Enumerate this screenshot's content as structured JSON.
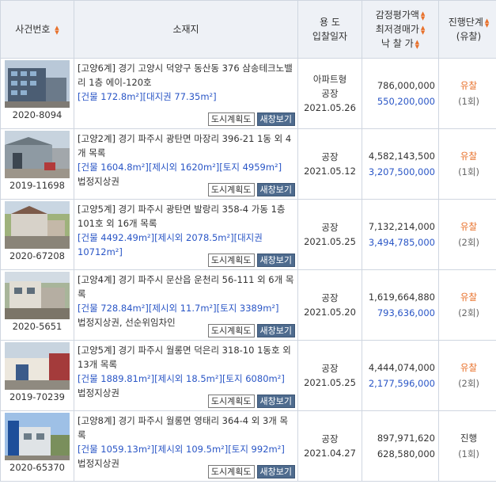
{
  "header": {
    "case": "사건번호",
    "location": "소재지",
    "use_line1": "용 도",
    "use_line2": "입찰일자",
    "price_line1": "감정평가액",
    "price_line2": "최저경매가",
    "price_line3": "낙 찰 가",
    "status_line1": "진행단계",
    "status_line2": "(유찰)"
  },
  "buttons": {
    "map": "도시계획도",
    "view": "새창보기"
  },
  "rows": [
    {
      "case_no": "2020-8094",
      "addr": "[고양6계] 경기 고양시 덕양구 동산동 376 삼송테크노밸리 1층 에이-120호",
      "area": "[건물 172.8m²][대지권 77.35m²]",
      "note": "",
      "use": [
        "아파트형",
        "공장"
      ],
      "date": "2021.05.26",
      "appraisal": "786,000,000",
      "min_price": "550,200,000",
      "status": "유찰",
      "count": "(1회)"
    },
    {
      "case_no": "2019-11698",
      "addr": "[고양2계] 경기 파주시 광탄면 마장리 396-21 1동 외 4개 목록",
      "area": "[건물 1604.8m²][제시외 1620m²][토지 4959m²]",
      "note": "법정지상권",
      "use": [
        "공장"
      ],
      "date": "2021.05.12",
      "appraisal": "4,582,143,500",
      "min_price": "3,207,500,000",
      "status": "유찰",
      "count": "(1회)"
    },
    {
      "case_no": "2020-67208",
      "addr": "[고양5계] 경기 파주시 광탄면 발랑리 358-4 가동 1층 101호 외 16개 목록",
      "area": "[건물 4492.49m²][제시외 2078.5m²][대지권 10712m²]",
      "note": "",
      "use": [
        "공장"
      ],
      "date": "2021.05.25",
      "appraisal": "7,132,214,000",
      "min_price": "3,494,785,000",
      "status": "유찰",
      "count": "(2회)"
    },
    {
      "case_no": "2020-5651",
      "addr": "[고양4계] 경기 파주시 문산읍 운천리 56-111 외 6개 목록",
      "area": "[건물 728.84m²][제시외 11.7m²][토지 3389m²]",
      "note": "법정지상권, 선순위임차인",
      "use": [
        "공장"
      ],
      "date": "2021.05.20",
      "appraisal": "1,619,664,880",
      "min_price": "793,636,000",
      "status": "유찰",
      "count": "(2회)"
    },
    {
      "case_no": "2019-70239",
      "addr": "[고양5계] 경기 파주시 월롱면 덕은리 318-10 1동호 외 13개 목록",
      "area": "[건물 1889.81m²][제시외 18.5m²][토지 6080m²]",
      "note": "법정지상권",
      "use": [
        "공장"
      ],
      "date": "2021.05.25",
      "appraisal": "4,444,074,000",
      "min_price": "2,177,596,000",
      "status": "유찰",
      "count": "(2회)"
    },
    {
      "case_no": "2020-65370",
      "addr": "[고양8계] 경기 파주시 월롱면 영태리 364-4 외 3개 목록",
      "area": "[건물 1059.13m²][제시외 109.5m²][토지 992m²]",
      "note": "법정지상권",
      "use": [
        "공장"
      ],
      "date": "2021.04.27",
      "appraisal": "897,971,620",
      "min_price": "628,580,000",
      "status": "진행",
      "count": "(1회)"
    }
  ],
  "colors": {
    "accent": "#e8702a",
    "link_blue": "#2a56c6",
    "header_bg": "#eef1f6",
    "view_button": "#4e6b8e"
  }
}
